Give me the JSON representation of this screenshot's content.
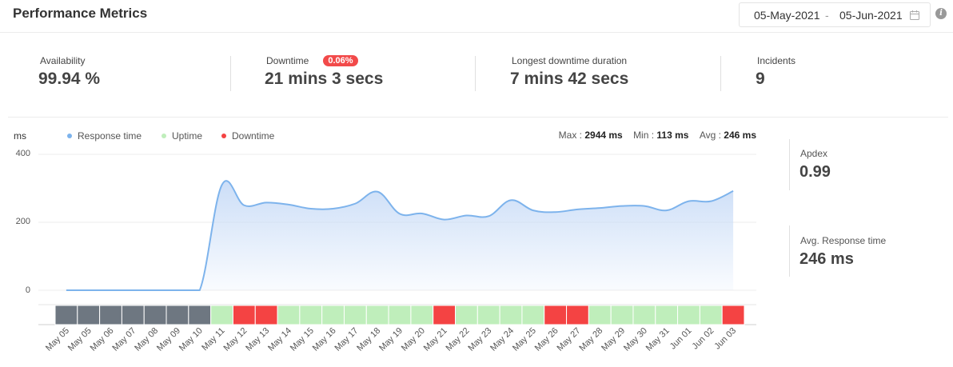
{
  "header": {
    "title": "Performance Metrics",
    "date_from": "05-May-2021",
    "date_sep": "-",
    "date_to": "05-Jun-2021",
    "calendar_icon": "calendar-icon",
    "info_icon": "info-icon",
    "info_glyph": "i"
  },
  "stats": {
    "availability_label": "Availability",
    "availability_value": "99.94 %",
    "downtime_label": "Downtime",
    "downtime_badge": "0.06%",
    "downtime_value": "21 mins 3 secs",
    "longest_label": "Longest downtime duration",
    "longest_value": "7 mins 42 secs",
    "incidents_label": "Incidents",
    "incidents_value": "9"
  },
  "chart_header": {
    "unit": "ms",
    "legend": [
      "Response time",
      "Uptime",
      "Downtime"
    ],
    "max_label": "Max :",
    "max_value": "2944 ms",
    "min_label": "Min :",
    "min_value": "113 ms",
    "avg_label": "Avg :",
    "avg_value": "246 ms"
  },
  "side": {
    "apdex_label": "Apdex",
    "apdex_value": "0.99",
    "avg_rt_label": "Avg. Response time",
    "avg_rt_value": "246 ms"
  },
  "colors": {
    "response": "#7db3ec",
    "response_fill_top": "#c9dcf7",
    "uptime": "#bfeebb",
    "downtime": "#f44343",
    "nodata": "#6e7781"
  },
  "chart_data": {
    "type": "area",
    "ylabel": "ms",
    "ylim": [
      0,
      400
    ],
    "yticks": [
      0,
      200,
      400
    ],
    "grid": true,
    "legend_position": "top-left",
    "series": [
      {
        "name": "Response time",
        "values": [
          0,
          0,
          0,
          0,
          0,
          0,
          0,
          310,
          250,
          258,
          252,
          240,
          240,
          255,
          290,
          225,
          226,
          208,
          220,
          218,
          265,
          235,
          230,
          238,
          242,
          248,
          248,
          235,
          262,
          262,
          292
        ]
      }
    ],
    "status_categories": [
      "May 05",
      "May 05",
      "May 06",
      "May 07",
      "May 08",
      "May 09",
      "May 10",
      "May 11",
      "May 12",
      "May 13",
      "May 14",
      "May 15",
      "May 16",
      "May 17",
      "May 18",
      "May 19",
      "May 20",
      "May 21",
      "May 22",
      "May 23",
      "May 24",
      "May 25",
      "May 26",
      "May 27",
      "May 28",
      "May 29",
      "May 30",
      "May 31",
      "Jun 01",
      "Jun 02",
      "Jun 03"
    ],
    "status": [
      "nodata",
      "nodata",
      "nodata",
      "nodata",
      "nodata",
      "nodata",
      "nodata",
      "uptime",
      "downtime",
      "downtime",
      "uptime",
      "uptime",
      "uptime",
      "uptime",
      "uptime",
      "uptime",
      "uptime",
      "downtime",
      "uptime",
      "uptime",
      "uptime",
      "uptime",
      "downtime",
      "downtime",
      "uptime",
      "uptime",
      "uptime",
      "uptime",
      "uptime",
      "uptime",
      "downtime"
    ]
  }
}
